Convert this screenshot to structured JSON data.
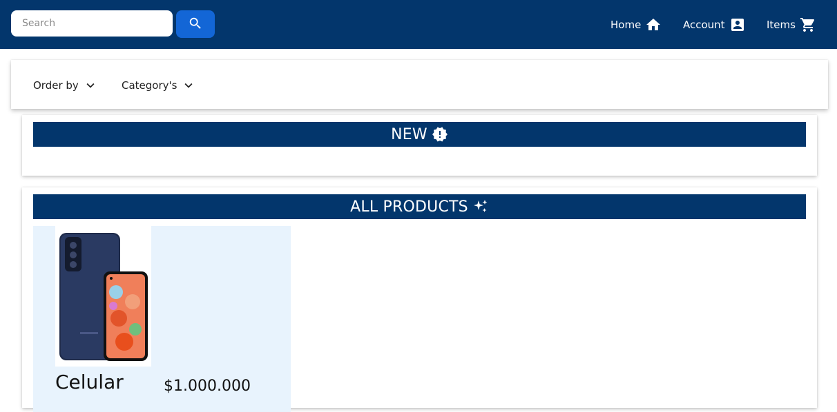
{
  "search": {
    "placeholder": "Search"
  },
  "nav": {
    "home_label": "Home",
    "account_label": "Account",
    "items_label": "Items"
  },
  "filters": {
    "order_label": "Order by",
    "category_label": "Category's"
  },
  "sections": {
    "new_title": "NEW",
    "all_title": "ALL PRODUCTS"
  },
  "products": [
    {
      "name": "Celular",
      "price": "$1.000.000"
    }
  ],
  "colors": {
    "header": "#03366c",
    "search_button": "#1366d6",
    "product_card": "#e8f3fd"
  },
  "icons": {
    "search": "search-icon",
    "home": "home-icon",
    "account": "account-box-icon",
    "cart": "cart-icon",
    "chevron": "chevron-down-icon",
    "new": "new-releases-icon",
    "all": "sparkles-icon"
  }
}
